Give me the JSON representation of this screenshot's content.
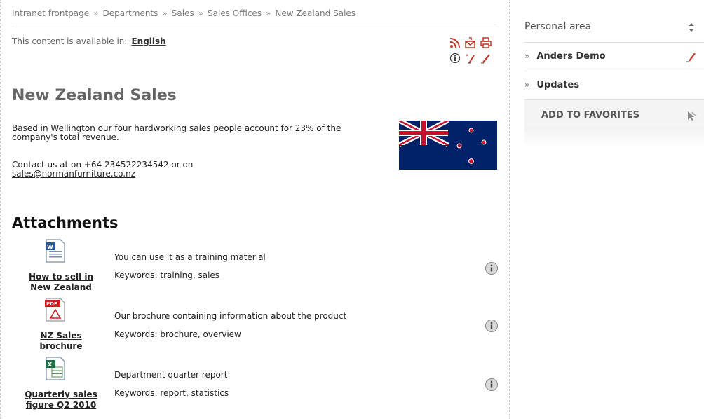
{
  "breadcrumb": [
    "Intranet frontpage",
    "Departments",
    "Sales",
    "Sales Offices",
    "New Zealand Sales"
  ],
  "breadcrumb_sep": "»",
  "language": {
    "label": "This content is available in:",
    "link": "English"
  },
  "page": {
    "title": "New Zealand Sales",
    "intro": "Based in Wellington our four hardworking sales people account for 23% of the company's total revenue.",
    "contact": "Contact us at on +64 234522234542 or on",
    "email": "sales@normanfurniture.co.nz"
  },
  "attachments_title": "Attachments",
  "attachments": [
    {
      "name": "How to sell in New Zealand",
      "type": "word",
      "description": "You can use it as a training material",
      "keywords": "Keywords: training, sales"
    },
    {
      "name": "NZ Sales brochure",
      "type": "pdf",
      "description": "Our brochure containing information about the product",
      "keywords": "Keywords: brochure, overview"
    },
    {
      "name": "Quarterly sales figure Q2 2010",
      "type": "excel",
      "description": "Department quarter report",
      "keywords": "Keywords: report, statistics"
    }
  ],
  "sidebar": {
    "header": "Personal area",
    "items": [
      {
        "label": "Anders Demo",
        "arrow": "»"
      },
      {
        "label": "Updates",
        "arrow": "»"
      }
    ],
    "favorites": "ADD TO FAVORITES"
  },
  "colors": {
    "accent": "#c0392b",
    "flag_blue": "#012169",
    "flag_red": "#c8102e"
  },
  "icons": [
    "rss-icon",
    "email-icon",
    "print-icon",
    "info-icon",
    "translate-icon",
    "edit-icon",
    "sort-icon",
    "pencil-icon",
    "favorites-icon"
  ]
}
